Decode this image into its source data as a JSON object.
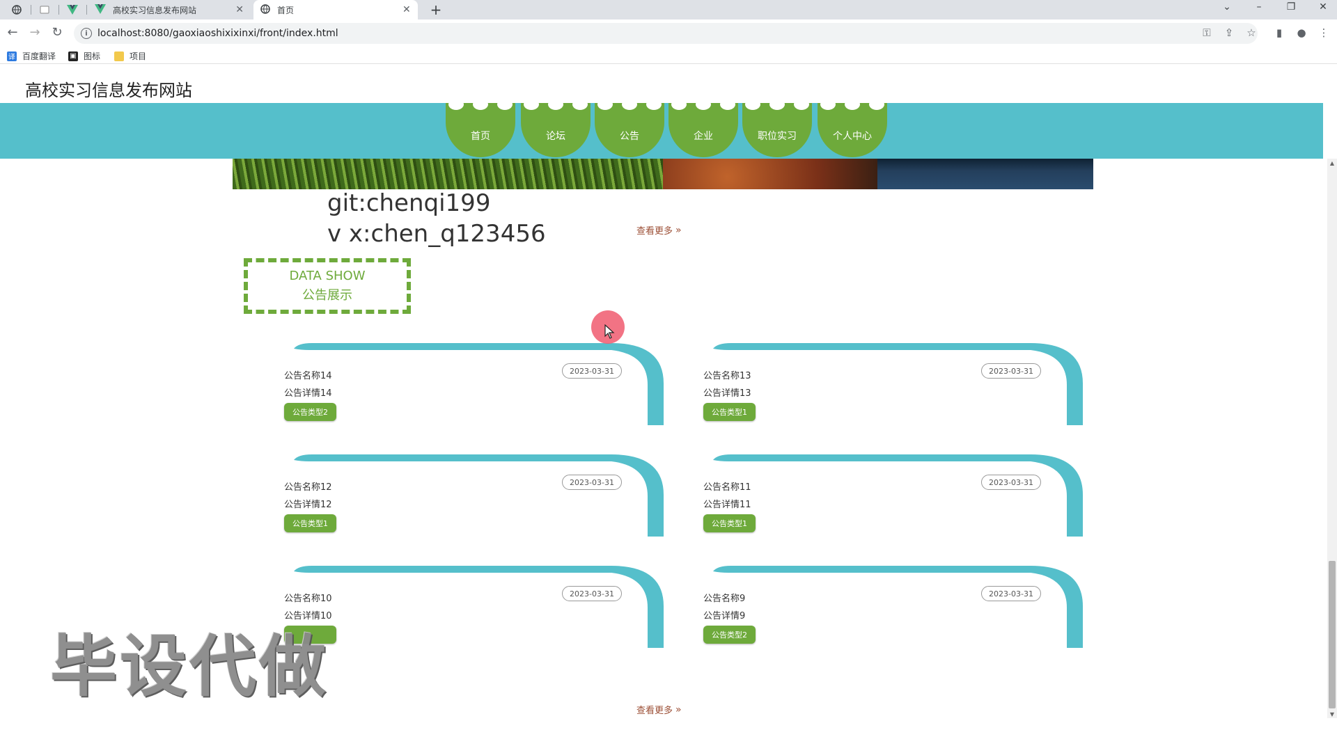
{
  "browser": {
    "tabs": [
      {
        "title": "高校实习信息发布网站",
        "active": false
      },
      {
        "title": "首页",
        "active": true
      }
    ],
    "url": "localhost:8080/gaoxiaoshixixinxi/front/index.html",
    "bookmarks": [
      "百度翻译",
      "图标",
      "项目"
    ]
  },
  "site": {
    "title": "高校实习信息发布网站",
    "nav": [
      "首页",
      "论坛",
      "公告",
      "企业",
      "职位实习",
      "个人中心"
    ]
  },
  "contact": {
    "git": "git:chenqi199",
    "vx": "v x:chen_q123456"
  },
  "more_label": "查看更多",
  "section": {
    "en_title": "DATA SHOW",
    "cn_title": "公告展示"
  },
  "notices": [
    {
      "name": "公告名称14",
      "detail": "公告详情14",
      "date": "2023-03-31",
      "type": "公告类型2"
    },
    {
      "name": "公告名称13",
      "detail": "公告详情13",
      "date": "2023-03-31",
      "type": "公告类型1"
    },
    {
      "name": "公告名称12",
      "detail": "公告详情12",
      "date": "2023-03-31",
      "type": "公告类型1"
    },
    {
      "name": "公告名称11",
      "detail": "公告详情11",
      "date": "2023-03-31",
      "type": "公告类型1"
    },
    {
      "name": "公告名称10",
      "detail": "公告详情10",
      "date": "2023-03-31",
      "type": ""
    },
    {
      "name": "公告名称9",
      "detail": "公告详情9",
      "date": "2023-03-31",
      "type": "公告类型2"
    }
  ],
  "watermark": "毕设代做",
  "colors": {
    "nav_bar": "#55bfcb",
    "accent_green": "#6eaa3b",
    "more_link": "#9c4f36"
  }
}
